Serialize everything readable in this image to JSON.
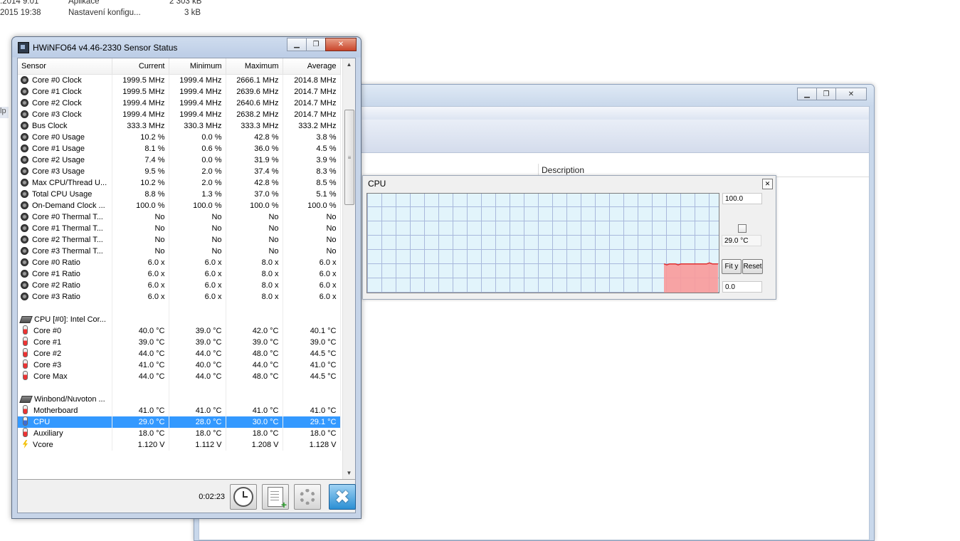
{
  "background": {
    "explorer_rows": [
      {
        "date": ".2014 9:01",
        "type": "Aplikace",
        "size": "2 303 kB"
      },
      {
        "date": "2015 19:38",
        "type": "Nastavení konfigu...",
        "size": "3 kB"
      }
    ],
    "left_tab": "lp",
    "column_header": "Description"
  },
  "hwinfo": {
    "title": "HWiNFO64 v4.46-2330 Sensor Status",
    "columns": [
      "Sensor",
      "Current",
      "Minimum",
      "Maximum",
      "Average"
    ],
    "rows": [
      {
        "icon": "gauge",
        "name": "Core #0 Clock",
        "current": "1999.5 MHz",
        "minimum": "1999.4 MHz",
        "maximum": "2666.1 MHz",
        "average": "2014.8 MHz"
      },
      {
        "icon": "gauge",
        "name": "Core #1 Clock",
        "current": "1999.5 MHz",
        "minimum": "1999.4 MHz",
        "maximum": "2639.6 MHz",
        "average": "2014.7 MHz"
      },
      {
        "icon": "gauge",
        "name": "Core #2 Clock",
        "current": "1999.4 MHz",
        "minimum": "1999.4 MHz",
        "maximum": "2640.6 MHz",
        "average": "2014.7 MHz"
      },
      {
        "icon": "gauge",
        "name": "Core #3 Clock",
        "current": "1999.4 MHz",
        "minimum": "1999.4 MHz",
        "maximum": "2638.2 MHz",
        "average": "2014.7 MHz"
      },
      {
        "icon": "gauge",
        "name": "Bus Clock",
        "current": "333.3 MHz",
        "minimum": "330.3 MHz",
        "maximum": "333.3 MHz",
        "average": "333.2 MHz"
      },
      {
        "icon": "gauge",
        "name": "Core #0 Usage",
        "current": "10.2 %",
        "minimum": "0.0 %",
        "maximum": "42.8 %",
        "average": "3.8 %"
      },
      {
        "icon": "gauge",
        "name": "Core #1 Usage",
        "current": "8.1 %",
        "minimum": "0.6 %",
        "maximum": "36.0 %",
        "average": "4.5 %"
      },
      {
        "icon": "gauge",
        "name": "Core #2 Usage",
        "current": "7.4 %",
        "minimum": "0.0 %",
        "maximum": "31.9 %",
        "average": "3.9 %"
      },
      {
        "icon": "gauge",
        "name": "Core #3 Usage",
        "current": "9.5 %",
        "minimum": "2.0 %",
        "maximum": "37.4 %",
        "average": "8.3 %"
      },
      {
        "icon": "gauge",
        "name": "Max CPU/Thread U...",
        "current": "10.2 %",
        "minimum": "2.0 %",
        "maximum": "42.8 %",
        "average": "8.5 %"
      },
      {
        "icon": "gauge",
        "name": "Total CPU Usage",
        "current": "8.8 %",
        "minimum": "1.3 %",
        "maximum": "37.0 %",
        "average": "5.1 %"
      },
      {
        "icon": "gauge",
        "name": "On-Demand Clock ...",
        "current": "100.0 %",
        "minimum": "100.0 %",
        "maximum": "100.0 %",
        "average": "100.0 %"
      },
      {
        "icon": "gauge",
        "name": "Core #0 Thermal T...",
        "current": "No",
        "minimum": "No",
        "maximum": "No",
        "average": "No"
      },
      {
        "icon": "gauge",
        "name": "Core #1 Thermal T...",
        "current": "No",
        "minimum": "No",
        "maximum": "No",
        "average": "No"
      },
      {
        "icon": "gauge",
        "name": "Core #2 Thermal T...",
        "current": "No",
        "minimum": "No",
        "maximum": "No",
        "average": "No"
      },
      {
        "icon": "gauge",
        "name": "Core #3 Thermal T...",
        "current": "No",
        "minimum": "No",
        "maximum": "No",
        "average": "No"
      },
      {
        "icon": "gauge",
        "name": "Core #0 Ratio",
        "current": "6.0 x",
        "minimum": "6.0 x",
        "maximum": "8.0 x",
        "average": "6.0 x"
      },
      {
        "icon": "gauge",
        "name": "Core #1 Ratio",
        "current": "6.0 x",
        "minimum": "6.0 x",
        "maximum": "8.0 x",
        "average": "6.0 x"
      },
      {
        "icon": "gauge",
        "name": "Core #2 Ratio",
        "current": "6.0 x",
        "minimum": "6.0 x",
        "maximum": "8.0 x",
        "average": "6.0 x"
      },
      {
        "icon": "gauge",
        "name": "Core #3 Ratio",
        "current": "6.0 x",
        "minimum": "6.0 x",
        "maximum": "8.0 x",
        "average": "6.0 x"
      },
      {
        "icon": "blank",
        "name": "",
        "current": "",
        "minimum": "",
        "maximum": "",
        "average": ""
      },
      {
        "icon": "chip",
        "name": "CPU [#0]: Intel Cor...",
        "current": "",
        "minimum": "",
        "maximum": "",
        "average": ""
      },
      {
        "icon": "thermo",
        "name": "Core #0",
        "current": "40.0 °C",
        "minimum": "39.0 °C",
        "maximum": "42.0 °C",
        "average": "40.1 °C"
      },
      {
        "icon": "thermo",
        "name": "Core #1",
        "current": "39.0 °C",
        "minimum": "39.0 °C",
        "maximum": "39.0 °C",
        "average": "39.0 °C"
      },
      {
        "icon": "thermo",
        "name": "Core #2",
        "current": "44.0 °C",
        "minimum": "44.0 °C",
        "maximum": "48.0 °C",
        "average": "44.5 °C"
      },
      {
        "icon": "thermo",
        "name": "Core #3",
        "current": "41.0 °C",
        "minimum": "40.0 °C",
        "maximum": "44.0 °C",
        "average": "41.0 °C"
      },
      {
        "icon": "thermo",
        "name": "Core Max",
        "current": "44.0 °C",
        "minimum": "44.0 °C",
        "maximum": "48.0 °C",
        "average": "44.5 °C"
      },
      {
        "icon": "blank",
        "name": "",
        "current": "",
        "minimum": "",
        "maximum": "",
        "average": ""
      },
      {
        "icon": "chip",
        "name": "Winbond/Nuvoton ...",
        "current": "",
        "minimum": "",
        "maximum": "",
        "average": ""
      },
      {
        "icon": "thermo",
        "name": "Motherboard",
        "current": "41.0 °C",
        "minimum": "41.0 °C",
        "maximum": "41.0 °C",
        "average": "41.0 °C"
      },
      {
        "icon": "thermo-blue",
        "name": "CPU",
        "current": "29.0 °C",
        "minimum": "28.0 °C",
        "maximum": "30.0 °C",
        "average": "29.1 °C",
        "selected": true
      },
      {
        "icon": "thermo",
        "name": "Auxiliary",
        "current": "18.0 °C",
        "minimum": "18.0 °C",
        "maximum": "18.0 °C",
        "average": "18.0 °C"
      },
      {
        "icon": "bolt",
        "name": "Vcore",
        "current": "1.120 V",
        "minimum": "1.112 V",
        "maximum": "1.208 V",
        "average": "1.128 V"
      }
    ],
    "elapsed": "0:02:23",
    "colors": {
      "selection": "#3399ff",
      "close_button": "#2b8fd4"
    }
  },
  "cpu_graph": {
    "title": "CPU",
    "max_value": "100.0",
    "min_value": "0.0",
    "current_reading": "29.0 °C",
    "fit_y_label": "Fit y",
    "reset_label": "Reset",
    "colors": {
      "background": "#e2f4fb",
      "grid": "#a9b9dc",
      "fill": "#f99a9a",
      "line": "#e03030"
    },
    "y_min": 0,
    "y_max": 100,
    "history": [
      29,
      28,
      29,
      29,
      29,
      28,
      29,
      29,
      29,
      29,
      29,
      29,
      29,
      29,
      29,
      29,
      30,
      29,
      29,
      29
    ]
  }
}
